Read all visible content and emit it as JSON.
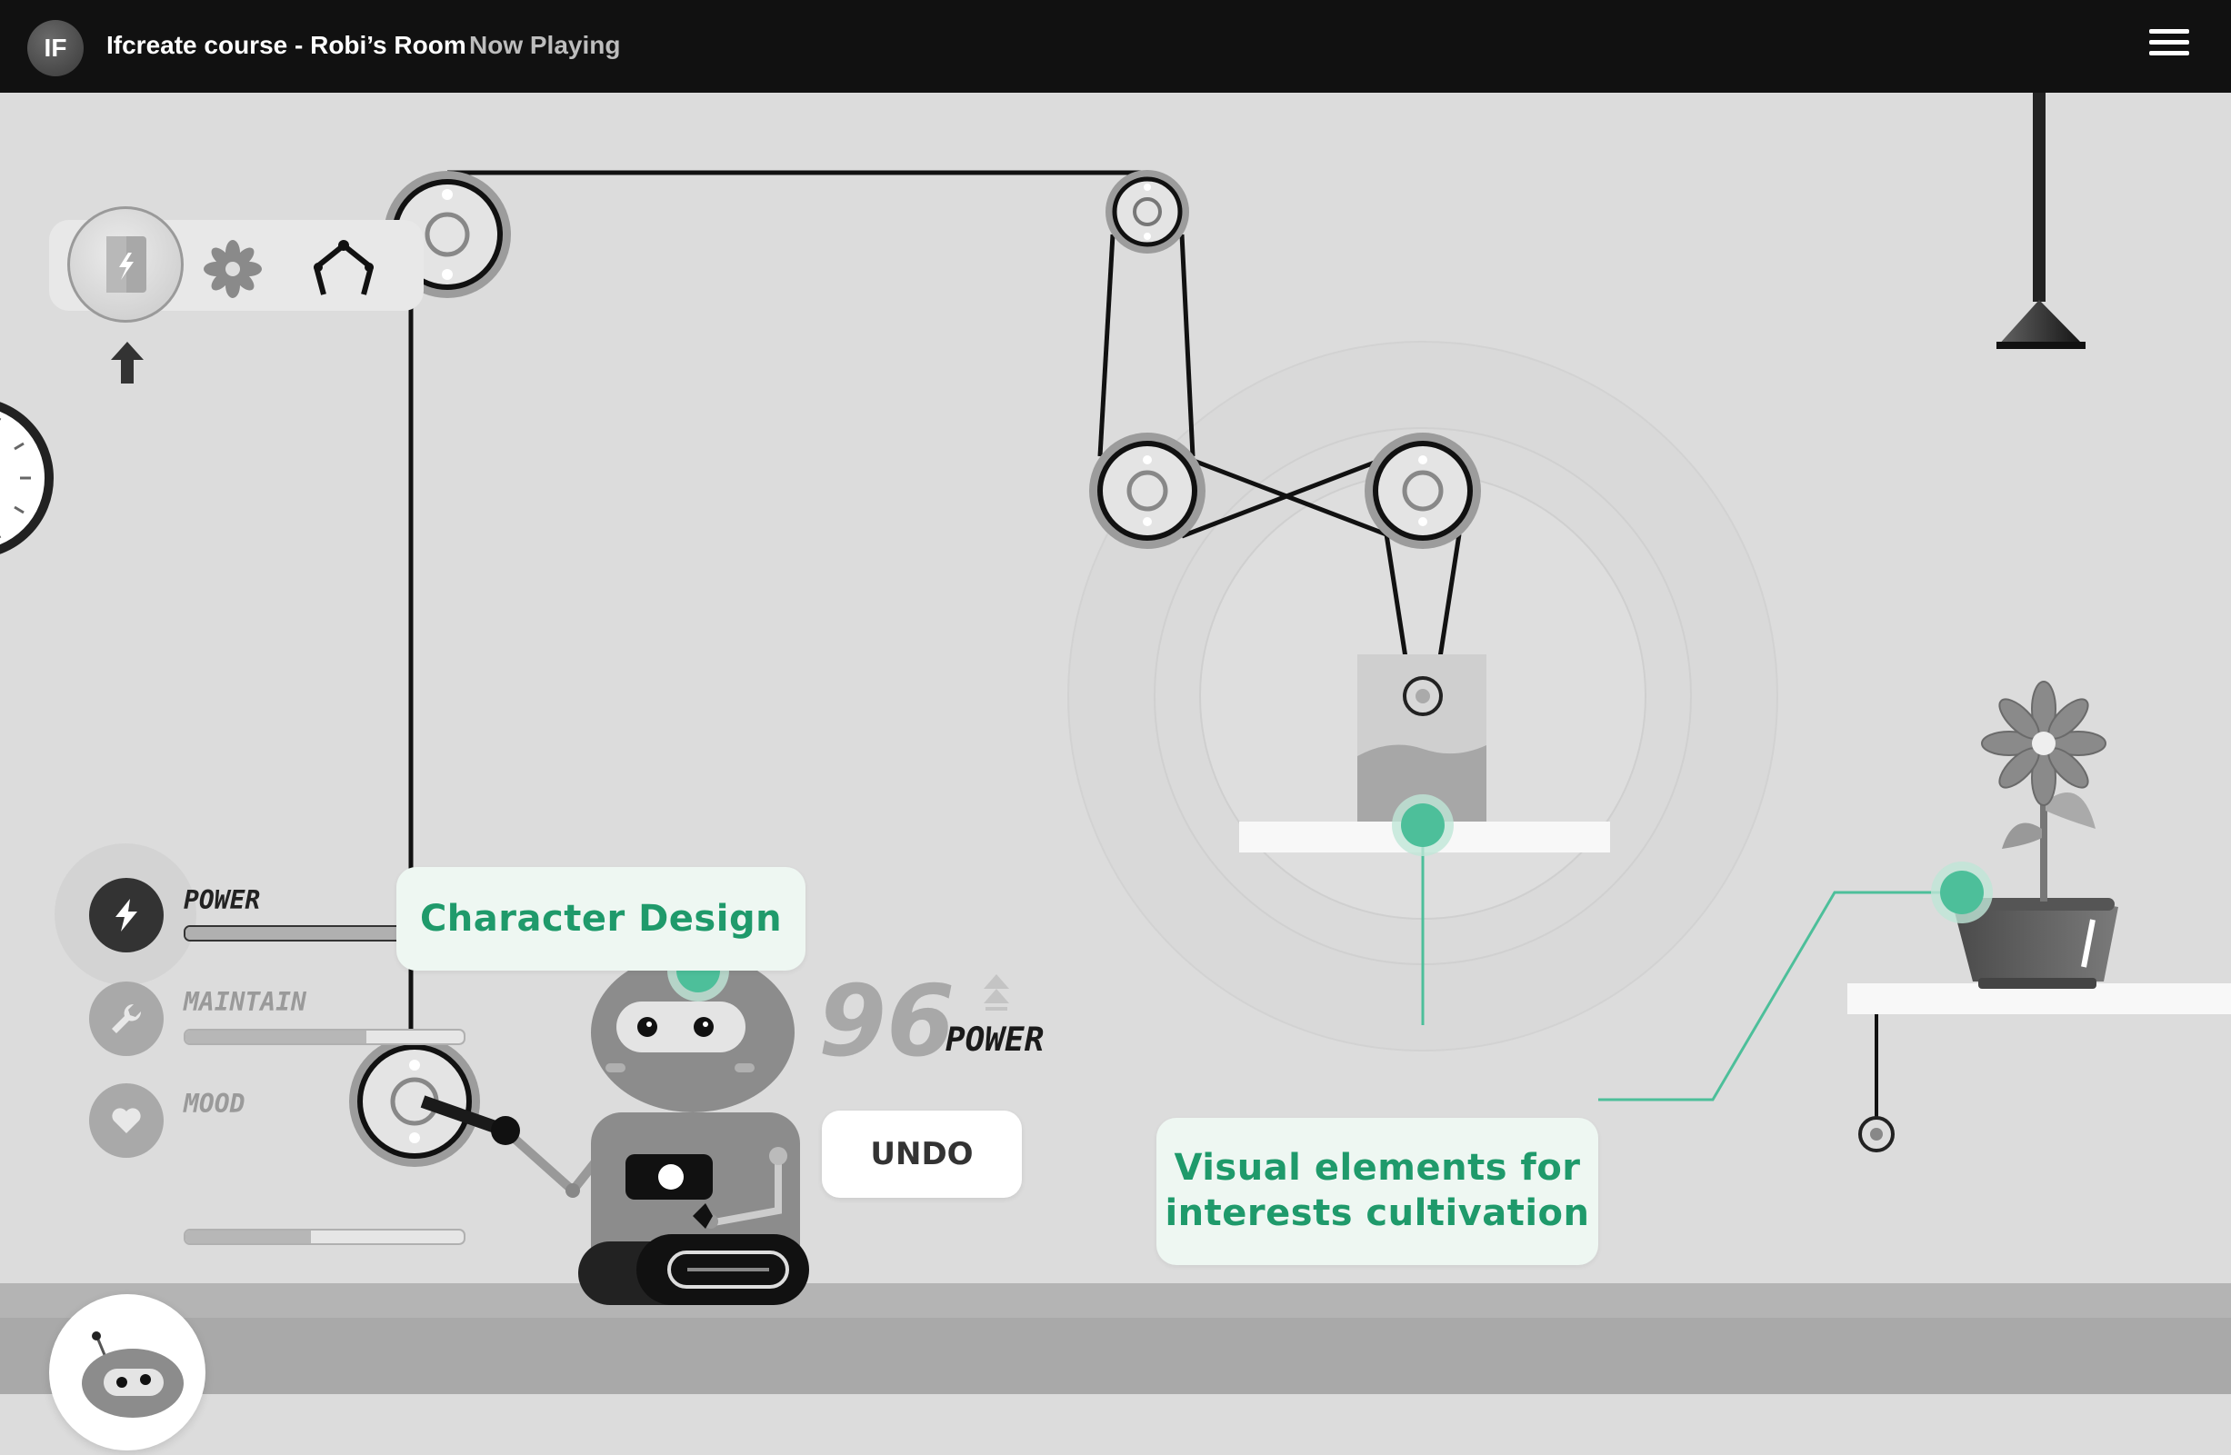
{
  "header": {
    "logo_text": "IF",
    "title": "Ifcreate course - Robi’s Room",
    "status": "Now Playing"
  },
  "toolbar": {
    "tools": [
      "battery-icon",
      "gear-flower-icon",
      "robot-claw-icon"
    ]
  },
  "stats": [
    {
      "label": "POWER",
      "icon": "bolt-icon",
      "level": 0.98,
      "active": true
    },
    {
      "label": "MAINTAIN",
      "icon": "wrench-icon",
      "level": 0.65,
      "active": false
    },
    {
      "label": "MOOD",
      "icon": "heart-icon",
      "level": 0.45,
      "active": false
    }
  ],
  "score": {
    "value": "96",
    "unit": "POWER"
  },
  "undo_label": "UNDO",
  "callouts": {
    "character": "Character Design",
    "visual_line1": "Visual elements for",
    "visual_line2": "interests cultivation"
  },
  "colors": {
    "accent": "#4dbf9a",
    "accent_text": "#1f9a6b",
    "topbar": "#111111"
  }
}
